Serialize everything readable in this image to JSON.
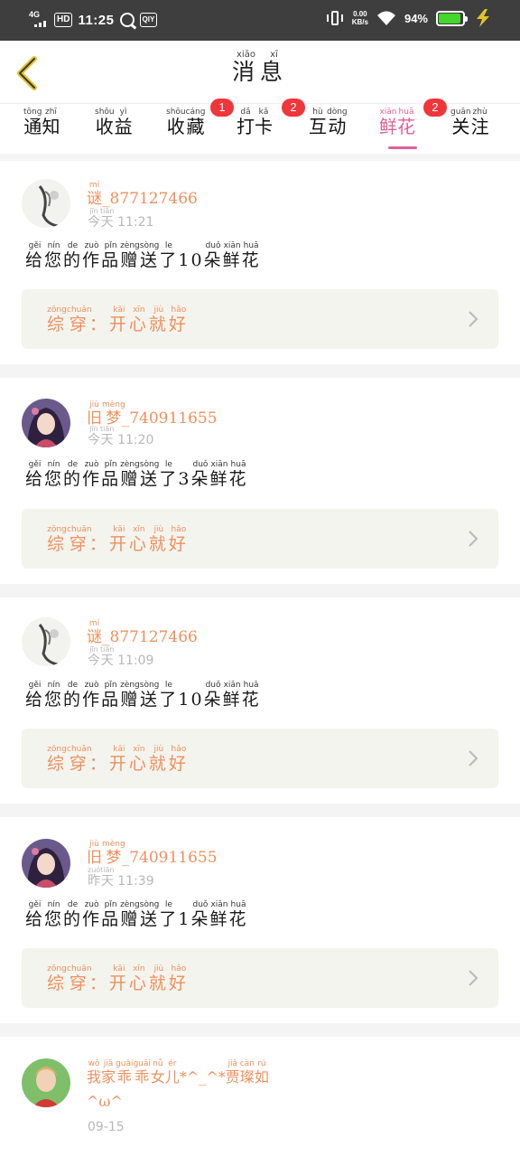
{
  "status_bar": {
    "network": "4G",
    "hd": "HD",
    "time": "11:25",
    "app_badge": "QIY",
    "speed_top": "0.00",
    "speed_bottom": "KB/s",
    "battery": "94%"
  },
  "header": {
    "title": [
      {
        "c": "消",
        "p": "xiāo"
      },
      {
        "c": "息",
        "p": "xī"
      }
    ]
  },
  "tabs": [
    {
      "key": "notice",
      "chars": [
        {
          "c": "通",
          "p": "tōng"
        },
        {
          "c": "知",
          "p": "zhī"
        }
      ],
      "badge": ""
    },
    {
      "key": "income",
      "chars": [
        {
          "c": "收",
          "p": "shōu"
        },
        {
          "c": "益",
          "p": "yì"
        }
      ],
      "badge": ""
    },
    {
      "key": "favorite",
      "chars": [
        {
          "c": "收",
          "p": "shōu"
        },
        {
          "c": "藏",
          "p": "cáng"
        }
      ],
      "badge": "1"
    },
    {
      "key": "checkin",
      "chars": [
        {
          "c": "打",
          "p": "dǎ"
        },
        {
          "c": "卡",
          "p": "kǎ"
        }
      ],
      "badge": "2"
    },
    {
      "key": "interact",
      "chars": [
        {
          "c": "互",
          "p": "hù"
        },
        {
          "c": "动",
          "p": "dòng"
        }
      ],
      "badge": ""
    },
    {
      "key": "flower",
      "chars": [
        {
          "c": "鲜",
          "p": "xiān"
        },
        {
          "c": "花",
          "p": "huā"
        }
      ],
      "badge": "2",
      "active": true
    },
    {
      "key": "follow",
      "chars": [
        {
          "c": "关",
          "p": "guān"
        },
        {
          "c": "注",
          "p": "zhù"
        }
      ],
      "badge": ""
    }
  ],
  "colors": {
    "accent": "#e0609a",
    "name": "#f08f5c",
    "badge": "#f0353b"
  },
  "feed": [
    {
      "user": [
        {
          "c": "谜",
          "p": "mí"
        },
        {
          "c": "_877127466",
          "p": ""
        }
      ],
      "time": [
        {
          "c": "今",
          "p": "jīn"
        },
        {
          "c": "天",
          "p": "tiān"
        },
        {
          "c": " 11:21",
          "p": ""
        }
      ],
      "message": [
        {
          "c": "给",
          "p": "gěi"
        },
        {
          "c": "您",
          "p": "nín"
        },
        {
          "c": "的",
          "p": "de"
        },
        {
          "c": "作",
          "p": "zuò"
        },
        {
          "c": "品",
          "p": "pǐn"
        },
        {
          "c": "赠",
          "p": "zèng"
        },
        {
          "c": "送",
          "p": "sòng"
        },
        {
          "c": "了",
          "p": "le"
        },
        {
          "c": "10",
          "p": ""
        },
        {
          "c": "朵",
          "p": "duǒ"
        },
        {
          "c": "鲜",
          "p": "xiān"
        },
        {
          "c": "花",
          "p": "huā"
        }
      ],
      "work": [
        {
          "c": "综",
          "p": "zōng"
        },
        {
          "c": "穿",
          "p": "chuān"
        },
        {
          "c": "：",
          "p": ""
        },
        {
          "c": "开",
          "p": "kāi"
        },
        {
          "c": "心",
          "p": "xīn"
        },
        {
          "c": "就",
          "p": "jiù"
        },
        {
          "c": "好",
          "p": "hǎo"
        }
      ],
      "avatar": "ink-painting-avatar"
    },
    {
      "user": [
        {
          "c": "旧",
          "p": "jiù"
        },
        {
          "c": "梦",
          "p": "mèng"
        },
        {
          "c": "_740911655",
          "p": ""
        }
      ],
      "time": [
        {
          "c": "今",
          "p": "jīn"
        },
        {
          "c": "天",
          "p": "tiān"
        },
        {
          "c": " 11:20",
          "p": ""
        }
      ],
      "message": [
        {
          "c": "给",
          "p": "gěi"
        },
        {
          "c": "您",
          "p": "nín"
        },
        {
          "c": "的",
          "p": "de"
        },
        {
          "c": "作",
          "p": "zuò"
        },
        {
          "c": "品",
          "p": "pǐn"
        },
        {
          "c": "赠",
          "p": "zèng"
        },
        {
          "c": "送",
          "p": "sòng"
        },
        {
          "c": "了",
          "p": "le"
        },
        {
          "c": "3",
          "p": ""
        },
        {
          "c": "朵",
          "p": "duǒ"
        },
        {
          "c": "鲜",
          "p": "xiān"
        },
        {
          "c": "花",
          "p": "huā"
        }
      ],
      "work": [
        {
          "c": "综",
          "p": "zōng"
        },
        {
          "c": "穿",
          "p": "chuān"
        },
        {
          "c": "：",
          "p": ""
        },
        {
          "c": "开",
          "p": "kāi"
        },
        {
          "c": "心",
          "p": "xīn"
        },
        {
          "c": "就",
          "p": "jiù"
        },
        {
          "c": "好",
          "p": "hǎo"
        }
      ],
      "avatar": "anime-girl-avatar"
    },
    {
      "user": [
        {
          "c": "谜",
          "p": "mí"
        },
        {
          "c": "_877127466",
          "p": ""
        }
      ],
      "time": [
        {
          "c": "今",
          "p": "jīn"
        },
        {
          "c": "天",
          "p": "tiān"
        },
        {
          "c": " 11:09",
          "p": ""
        }
      ],
      "message": [
        {
          "c": "给",
          "p": "gěi"
        },
        {
          "c": "您",
          "p": "nín"
        },
        {
          "c": "的",
          "p": "de"
        },
        {
          "c": "作",
          "p": "zuò"
        },
        {
          "c": "品",
          "p": "pǐn"
        },
        {
          "c": "赠",
          "p": "zèng"
        },
        {
          "c": "送",
          "p": "sòng"
        },
        {
          "c": "了",
          "p": "le"
        },
        {
          "c": "10",
          "p": ""
        },
        {
          "c": "朵",
          "p": "duǒ"
        },
        {
          "c": "鲜",
          "p": "xiān"
        },
        {
          "c": "花",
          "p": "huā"
        }
      ],
      "work": [
        {
          "c": "综",
          "p": "zōng"
        },
        {
          "c": "穿",
          "p": "chuān"
        },
        {
          "c": "：",
          "p": ""
        },
        {
          "c": "开",
          "p": "kāi"
        },
        {
          "c": "心",
          "p": "xīn"
        },
        {
          "c": "就",
          "p": "jiù"
        },
        {
          "c": "好",
          "p": "hǎo"
        }
      ],
      "avatar": "ink-painting-avatar"
    },
    {
      "user": [
        {
          "c": "旧",
          "p": "jiù"
        },
        {
          "c": "梦",
          "p": "mèng"
        },
        {
          "c": "_740911655",
          "p": ""
        }
      ],
      "time": [
        {
          "c": "昨",
          "p": "zuó"
        },
        {
          "c": "天",
          "p": "tiān"
        },
        {
          "c": " 11:39",
          "p": ""
        }
      ],
      "message": [
        {
          "c": "给",
          "p": "gěi"
        },
        {
          "c": "您",
          "p": "nín"
        },
        {
          "c": "的",
          "p": "de"
        },
        {
          "c": "作",
          "p": "zuò"
        },
        {
          "c": "品",
          "p": "pǐn"
        },
        {
          "c": "赠",
          "p": "zèng"
        },
        {
          "c": "送",
          "p": "sòng"
        },
        {
          "c": "了",
          "p": "le"
        },
        {
          "c": "1",
          "p": ""
        },
        {
          "c": "朵",
          "p": "duǒ"
        },
        {
          "c": "鲜",
          "p": "xiān"
        },
        {
          "c": "花",
          "p": "huā"
        }
      ],
      "work": [
        {
          "c": "综",
          "p": "zōng"
        },
        {
          "c": "穿",
          "p": "chuān"
        },
        {
          "c": "：",
          "p": ""
        },
        {
          "c": "开",
          "p": "kāi"
        },
        {
          "c": "心",
          "p": "xīn"
        },
        {
          "c": "就",
          "p": "jiù"
        },
        {
          "c": "好",
          "p": "hǎo"
        }
      ],
      "avatar": "anime-girl-avatar"
    },
    {
      "user": [
        {
          "c": "我",
          "p": "wǒ"
        },
        {
          "c": "家",
          "p": "jiā"
        },
        {
          "c": "乖",
          "p": "guāi"
        },
        {
          "c": "乖",
          "p": "guāi"
        },
        {
          "c": "女",
          "p": "nǚ"
        },
        {
          "c": "儿",
          "p": "ér"
        },
        {
          "c": "*^_^*",
          "p": ""
        },
        {
          "c": "贾",
          "p": "jiǎ"
        },
        {
          "c": "璨",
          "p": "càn"
        },
        {
          "c": "如",
          "p": "rú"
        }
      ],
      "user_line2": "^ω^",
      "time": [
        {
          "c": "09-15",
          "p": ""
        }
      ],
      "avatar": "child-photo-avatar"
    }
  ]
}
